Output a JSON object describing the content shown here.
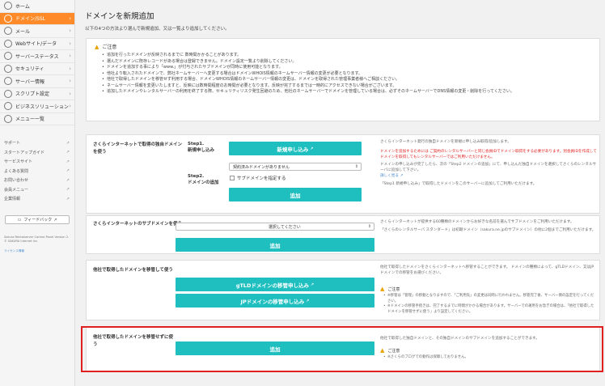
{
  "sidebar": {
    "items": [
      {
        "label": "ホーム",
        "icon": "home-icon",
        "active": false,
        "chevron": false
      },
      {
        "label": "ドメイン/SSL",
        "icon": "globe-icon",
        "active": true,
        "chevron": true
      },
      {
        "label": "メール",
        "icon": "mail-icon",
        "active": false,
        "chevron": true
      },
      {
        "label": "Webサイト/データ",
        "icon": "web-icon",
        "active": false,
        "chevron": true
      },
      {
        "label": "サーバーステータス",
        "icon": "status-icon",
        "active": false,
        "chevron": true
      },
      {
        "label": "セキュリティ",
        "icon": "lock-icon",
        "active": false,
        "chevron": true
      },
      {
        "label": "サーバー情報",
        "icon": "server-icon",
        "active": false,
        "chevron": true
      },
      {
        "label": "スクリプト設定",
        "icon": "script-icon",
        "active": false,
        "chevron": true
      },
      {
        "label": "ビジネスソリューション",
        "icon": "business-icon",
        "active": false,
        "chevron": true
      },
      {
        "label": "メニュー一覧",
        "icon": "menu-icon",
        "active": false,
        "chevron": false
      }
    ],
    "links": [
      "サポート",
      "スタートアップガイド",
      "サービスサイト",
      "よくある質問",
      "お問い合わせ",
      "会員メニュー",
      "企業情報"
    ],
    "feedback_label": "フィードバック",
    "footer": "Sakura Rentalserver Control Panel Version 2. © SAKURA Internet Inc.",
    "footer_link": "ライセンス情報"
  },
  "main": {
    "title": "ドメインを新規追加",
    "intro": "以下の4つの方法より選んで新規追加、又は一覧より追加してください。",
    "notice": {
      "heading": "ご注意",
      "items": [
        "追加を行ったドメインが反映されるまでに 数時間かかることがあります。",
        "選んだドメインに既存レコードがある場合は登録できません。ドメイン設定一覧より削除してください。",
        "ドメインを追加する事により「www.」が付与されたサブドメインが同時に使用可能となります。",
        "他社より転入されたドメインで、弊社ネームサーバーへ変更する場合はドメインWHOIS情報のネームサーバー情報の変更が必要となります。",
        "他社で取得したドメインを移管せず利用する場合、ドメインWHOIS情報のネームサーバー情報の変更は、ドメインを取得された管理事業者様へご相談ください。",
        "ネームサーバー情報を変更いたしますと、反映には数時間程度のお時間が必要となります。反映が完了するまでは一時的にアクセスできない場合がございます。",
        "追加したドメインやレンタルサーバーの利用を終了する際、セキュリティリスク発生回避のため、他社のネームサーバーでドメインを管理している場合は、必ずそのネームサーバーでDNS情報の変更・削除を行ってください。"
      ]
    },
    "card1": {
      "title": "さくらインターネットで取得の独自ドメインを使う",
      "step1_title": "Step1.",
      "step1_sub": "新規申し込み",
      "new_btn": "新規申し込み",
      "step2_title": "Step2.",
      "step2_sub": "ドメインの追加",
      "select_value": "契約済みドメインがありません",
      "checkbox_label": "サブドメインを指定する",
      "add_btn": "追加",
      "desc1": "さくらインターネット発行の独自ドメインを新規に申し込み取得/追加します。",
      "desc_red": "ドメインを追加するためには ご契約のレンタルサーバーと同じ会員IDでドメイン取得をする必要があります。別会員IDを作成して ドメインを取得してもレンタルサーバーではご利用いただけません。",
      "desc2": "ドメインの申し込みが完了したら、次の「Step2 ドメインの追加」にて、申し込んだ独自ドメインを選択してさくらのレンタルサーバに追加して下さい。",
      "more_link": "詳しく見る",
      "desc3": "「Step1 新規申し込み」で取得したドメインをこのサーバーに追加してご利用いただけます。"
    },
    "card2": {
      "title": "さくらインターネットのサブドメインを使う",
      "select_value": "選択してください",
      "add_btn": "追加",
      "desc1": "さくらインターネットが提供する60種類のドメインからお好きな名前を選んでサブドメインをご利用いただけます。",
      "desc2": "「さくらのレンタルサーバ スタンダード」は初期ドメイン（sakura.ne.jpのサブドメイン）の他に2個までご利用いただけます。"
    },
    "card3": {
      "title": "他社で取得したドメインを移管して使う",
      "gtld_btn": "gTLDドメインの移管申し込み",
      "jp_btn": "JPドメインの移管申し込み",
      "desc1": "他社で取得したドメインをさくらインターネットへ移管することができます。 ドメインの種類によって、gTLDドメイン、又はJPドメインでの移管をお選びください。",
      "notice_head": "ご注意",
      "items": [
        "※移管は「管理」の移動となりますので、「ご利用先」の変更は同時に行われません。移管完了後、サーバー側の設定を行ってください。",
        "※ドメインの移管手続きは、完了するまでに時間がかかる場合があります。サーバーでの運用をお急ぎの場合は、「他社で取得したドメインを移管せずに使う」より設定してください。"
      ]
    },
    "card4": {
      "title": "他社で取得したドメインを移管せずに使う",
      "add_btn": "追加",
      "desc1": "他社で取得した独自ドメインと、その独自ドメインのサブドメインを追加することができます。",
      "notice_head": "ご注意",
      "items": [
        "※さくらのブログでの動作は保障しておりません。"
      ]
    }
  },
  "colors": {
    "accent": "#ff8a2a",
    "button": "#1fbfc0",
    "warning": "#e9a300",
    "highlight": "#e02020"
  }
}
